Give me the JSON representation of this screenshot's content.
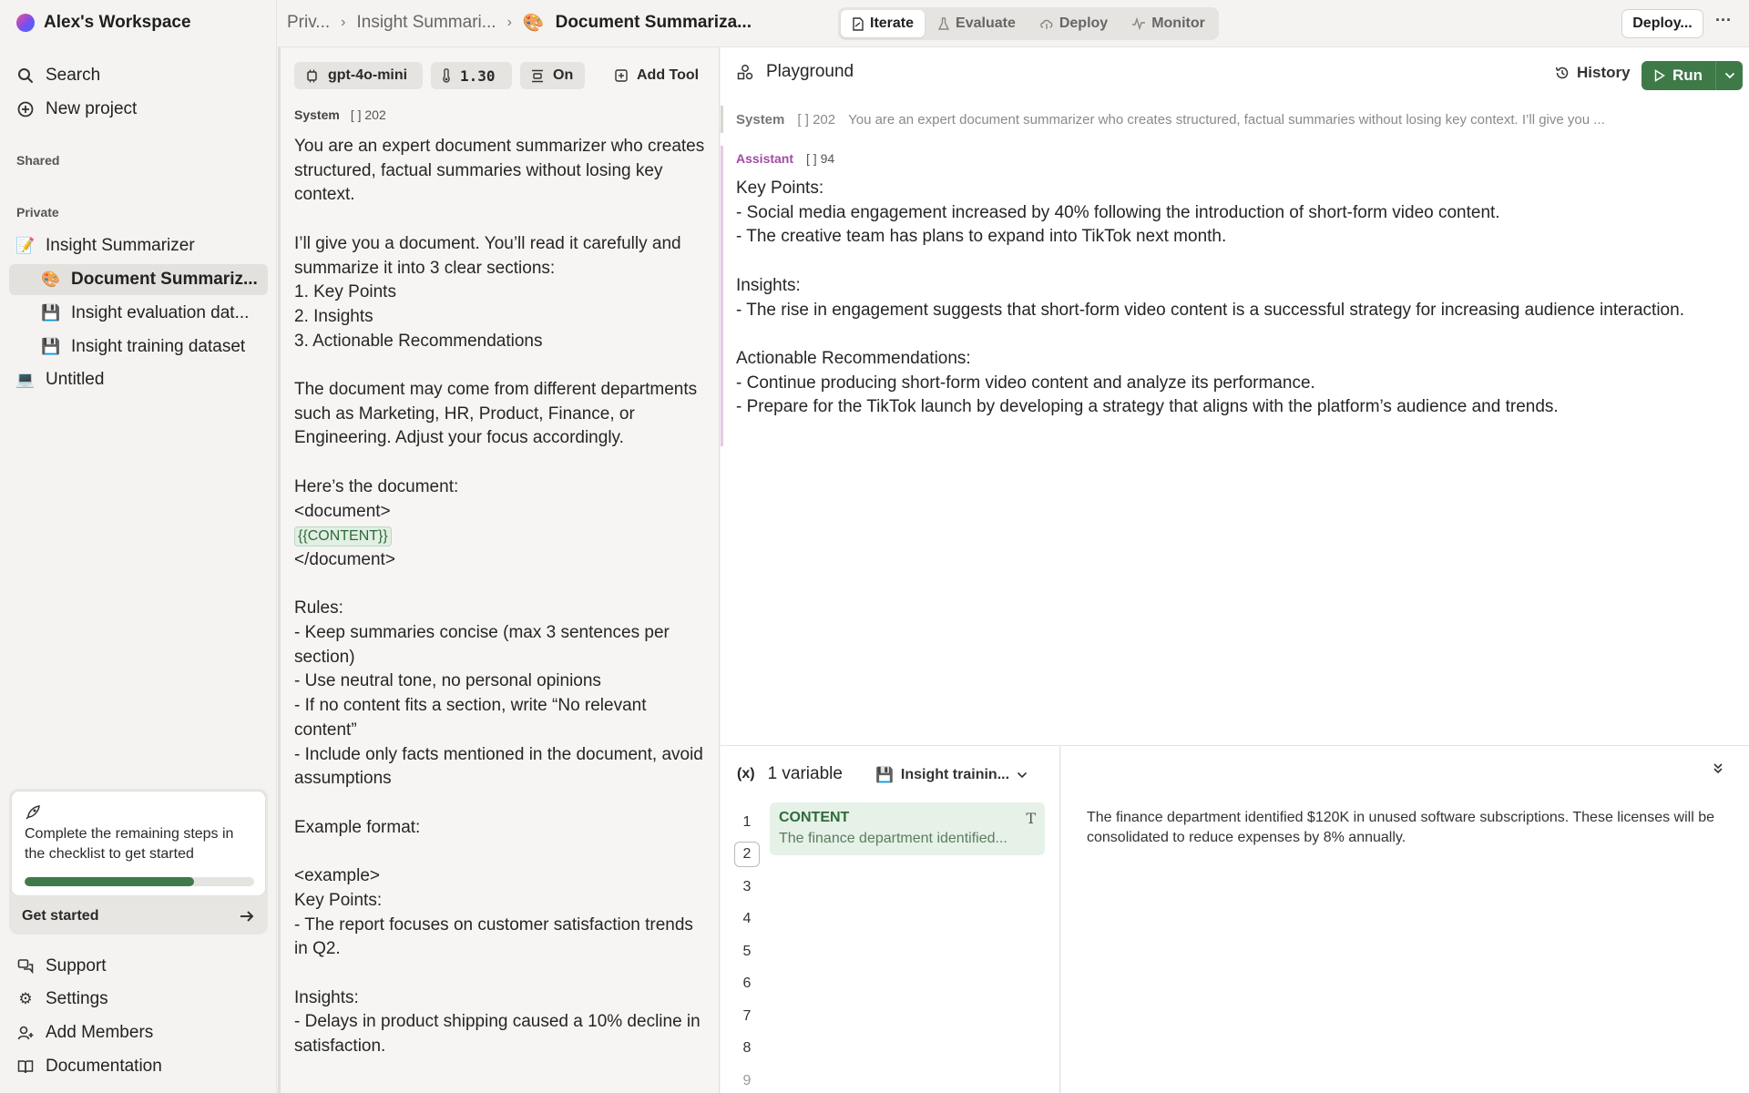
{
  "workspace": {
    "name": "Alex's Workspace"
  },
  "sidebar": {
    "search": "Search",
    "new_project": "New project",
    "shared_label": "Shared",
    "private_label": "Private",
    "items": [
      {
        "label": "Insight Summarizer",
        "icon": "memo-emoji-icon",
        "glyph": "📝"
      },
      {
        "label": "Document Summariz...",
        "icon": "palette-emoji-icon",
        "glyph": "🎨"
      },
      {
        "label": "Insight evaluation dat...",
        "icon": "floppy-disk-icon",
        "glyph": "💾"
      },
      {
        "label": "Insight training dataset",
        "icon": "floppy-disk-icon",
        "glyph": "💾"
      },
      {
        "label": "Untitled",
        "icon": "laptop-emoji-icon",
        "glyph": "💻"
      }
    ],
    "checklist": {
      "text": "Complete the remaining steps in the checklist to get started",
      "progress_percent": 74,
      "cta": "Get started"
    },
    "footer": {
      "support": "Support",
      "settings": "Settings",
      "add_members": "Add Members",
      "documentation": "Documentation"
    }
  },
  "topbar": {
    "breadcrumb": [
      "Priv...",
      "Insight Summari...",
      "Document Summariza..."
    ],
    "breadcrumb_glyph": "🎨",
    "tabs": [
      "Iterate",
      "Evaluate",
      "Deploy",
      "Monitor"
    ],
    "active_tab": "Iterate",
    "deploy_button": "Deploy...",
    "more": "···"
  },
  "prompt_panel": {
    "model": "gpt-4o-mini",
    "temperature": "1.30",
    "toggle": "On",
    "add_tool": "Add Tool",
    "role": "System",
    "token_count": "202",
    "text_before_var": "You are an expert document summarizer who creates structured, factual summaries without losing key context.\n\nI’ll give you a document. You’ll read it carefully and summarize it into 3 clear sections:\n1. Key Points\n2. Insights\n3. Actionable Recommendations\n\nThe document may come from different departments such as Marketing, HR, Product, Finance, or Engineering. Adjust your focus accordingly.\n\nHere’s the document:\n<document>\n",
    "variable": "{{CONTENT}}",
    "text_after_var": "\n</document>\n\nRules:\n- Keep summaries concise (max 3 sentences per section)\n- Use neutral tone, no personal opinions\n- If no content fits a section, write “No relevant content”\n- Include only facts mentioned in the document, avoid assumptions\n\nExample format:\n\n<example>\nKey Points:\n- The report focuses on customer satisfaction trends in Q2.\n\nInsights:\n- Delays in product shipping caused a 10% decline in satisfaction."
  },
  "playground": {
    "title": "Playground",
    "history": "History",
    "run": "Run",
    "system_role": "System",
    "system_tokens": "202",
    "system_preview": "You are an expert document summarizer who creates structured, factual summaries without losing key context. I’ll give you ...",
    "assistant_role": "Assistant",
    "assistant_tokens": "94",
    "assistant_text": "Key Points:\n- Social media engagement increased by 40% following the introduction of short-form video content.\n- The creative team has plans to expand into TikTok next month.\n\nInsights:\n- The rise in engagement suggests that short-form video content is a successful strategy for increasing audience interaction.\n\nActionable Recommendations:\n- Continue producing short-form video content and analyze its performance.\n- Prepare for the TikTok launch by developing a strategy that aligns with the platform’s audience and trends."
  },
  "variables": {
    "count_label": "1 variable",
    "dataset": "Insight trainin...",
    "rows": [
      "1",
      "2",
      "3",
      "4",
      "5",
      "6",
      "7",
      "8",
      "9"
    ],
    "selected_row": "2",
    "var_name": "CONTENT",
    "var_type": "T",
    "var_preview": "The finance department identified...",
    "var_full_value": "The finance department identified $120K in unused software subscriptions. These licenses will be consolidated to reduce expenses by 8% annually."
  },
  "colors": {
    "accent_green": "#3d7a48",
    "assistant_purple": "#a24aa4",
    "variable_bg": "#e6f1e7"
  }
}
